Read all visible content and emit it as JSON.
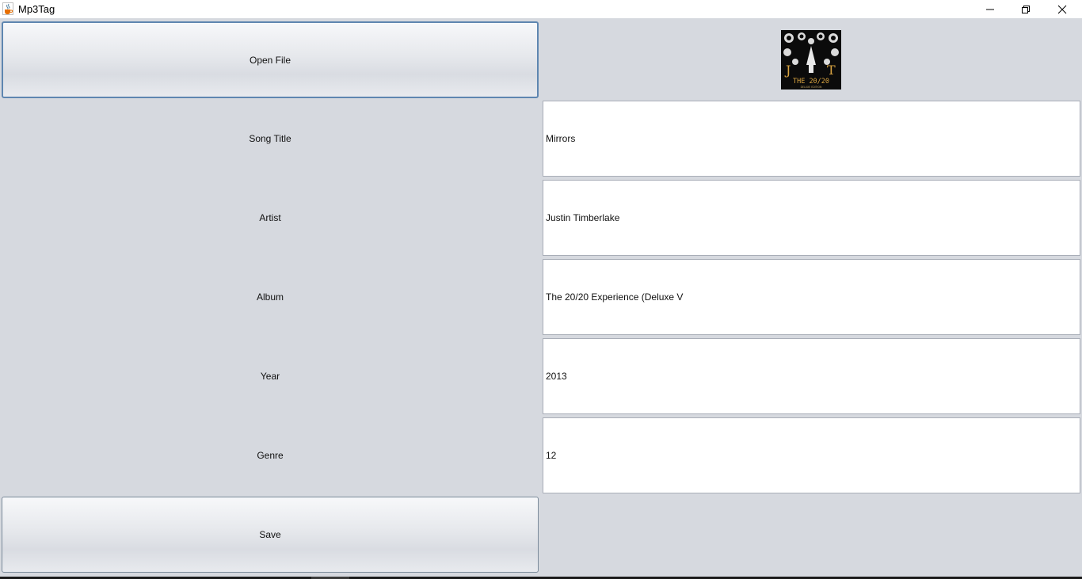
{
  "window": {
    "title": "Mp3Tag",
    "icons": {
      "app": "java-cup-icon",
      "minimize": "minimize-icon",
      "maximize": "restore-icon",
      "close": "close-icon"
    }
  },
  "buttons": {
    "open_label": "Open File",
    "save_label": "Save"
  },
  "album_art": {
    "letters_left": "J",
    "letters_right": "T",
    "caption": "THE 20/20",
    "subcaption": "DELUXE EDITION"
  },
  "fields": [
    {
      "label": "Song Title",
      "value": "Mirrors"
    },
    {
      "label": "Artist",
      "value": "Justin Timberlake"
    },
    {
      "label": "Album",
      "value": "The 20/20 Experience (Deluxe V"
    },
    {
      "label": "Year",
      "value": "2013"
    },
    {
      "label": "Genre",
      "value": "12"
    }
  ],
  "colors": {
    "background": "#d6d9df",
    "focus_border": "#5e86b0",
    "field_bg": "#ffffff"
  }
}
